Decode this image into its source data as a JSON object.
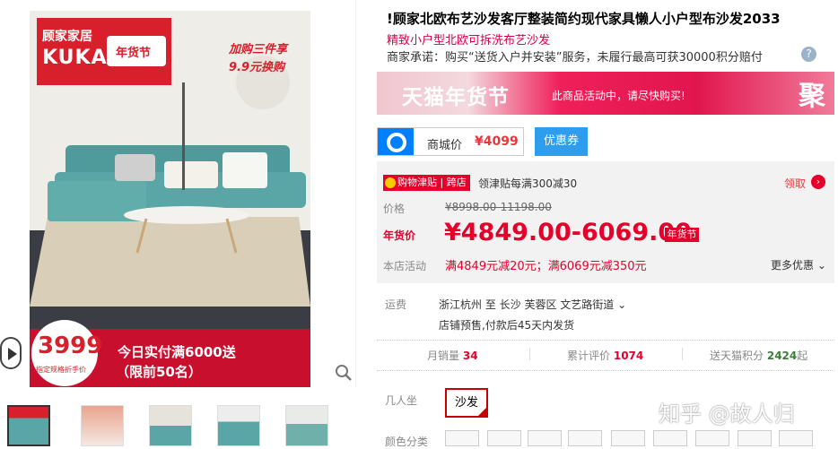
{
  "product": {
    "title": "!顾家北欧布艺沙发客厅整装简约现代家具懒人小户型布沙发2033",
    "subtitle": "精致小户型北欧可拆洗布艺沙发",
    "promise": "商家承诺：购买“送货入户并安装”服务，未履行最高可获30000积分赔付",
    "help_icon": "?"
  },
  "main_image": {
    "brand_cn": "顾家家居",
    "brand_en": "KUKA",
    "festival_tag": "年货节",
    "promo_line1": "加购三件享",
    "promo_line2": "9.9元换购",
    "price_badge": "3999",
    "price_badge_note": "指定规格折手价",
    "bottom_line1": "今日实付满6000送",
    "bottom_line2": "（限前50名）"
  },
  "banner": {
    "title": "天猫年货节",
    "text": "此商品活动中，请尽快购买!",
    "ju": "聚"
  },
  "store_price": {
    "label": "商城价",
    "price": "¥4099",
    "coupon_button": "优惠券"
  },
  "price_panel": {
    "jintie_badge": "购物津贴 | 跨店",
    "jintie_text": "领津贴每满300减30",
    "claim": "领取",
    "price_label": "价格",
    "original_price": "¥8998.00-11198.00",
    "sale_label": "年货价",
    "sale_price": "¥4849.00-6069.00",
    "sale_badge": "年货节",
    "activity_label": "本店活动",
    "activity_text": "满4849元减20元；满6069元减350元",
    "more": "更多优惠"
  },
  "shipping": {
    "label": "运费",
    "line": "浙江杭州 至 长沙 芙蓉区 文艺路街道",
    "note": "店铺预售,付款后45天内发货"
  },
  "stats": {
    "monthly_label": "月销量",
    "monthly_value": "34",
    "reviews_label": "累计评价",
    "reviews_value": "1074",
    "points_label": "送天猫积分",
    "points_value": "2424",
    "points_suffix": "起"
  },
  "options": {
    "seat_label": "几人坐",
    "seat_value": "沙发",
    "color_label": "颜色分类"
  },
  "watermark": "知乎 @故人归",
  "colors": {
    "tmall_red": "#e4002b",
    "coupon_blue": "#2f9dee",
    "brand_red": "#d8202d"
  }
}
